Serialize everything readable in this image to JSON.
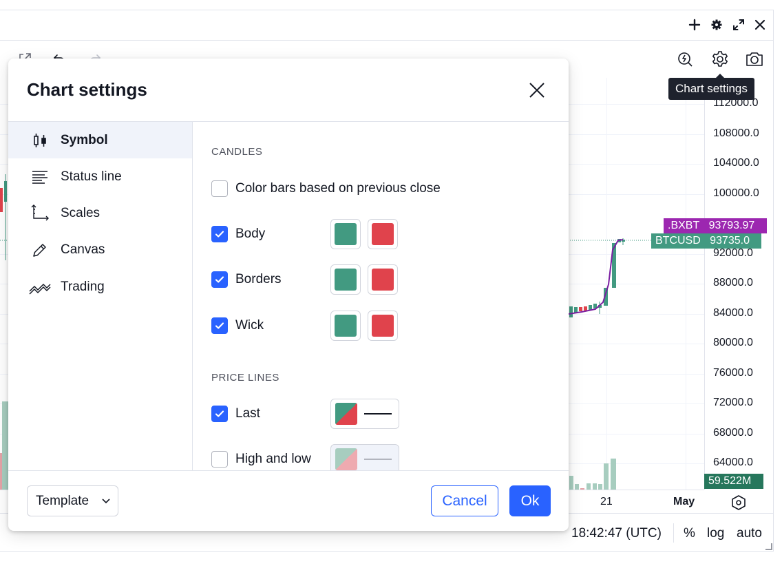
{
  "topbar": {
    "icons": [
      "plus-icon",
      "gear-icon",
      "expand-icon",
      "close-icon"
    ]
  },
  "toolbar": {
    "icons": [
      "popout-icon",
      "undo-icon",
      "redo-icon",
      "quick-search-icon",
      "settings-icon",
      "camera-icon"
    ]
  },
  "tooltip": {
    "text": "Chart settings"
  },
  "price_axis": {
    "ticks": [
      "112000.0",
      "108000.0",
      "104000.0",
      "100000.0",
      "92000.0",
      "88000.0",
      "84000.0",
      "80000.0",
      "76000.0",
      "72000.0",
      "68000.0",
      "64000.0"
    ],
    "tags": [
      {
        "name": ".BXBT",
        "value": "93793.97",
        "color": "#9c27b0"
      },
      {
        "name": "BTCUSD",
        "value": "93735.0",
        "color": "#429a81"
      },
      {
        "name": "",
        "value": "59.522M",
        "color": "#26775c"
      }
    ]
  },
  "time_axis": {
    "labels": [
      "21",
      "May"
    ]
  },
  "bottombar": {
    "time": "18:42:47 (UTC)",
    "percent": "%",
    "log": "log",
    "auto": "auto"
  },
  "modal": {
    "title": "Chart settings",
    "sidebar": [
      {
        "label": "Symbol",
        "icon": "candles-icon",
        "active": true
      },
      {
        "label": "Status line",
        "icon": "status-line-icon",
        "active": false
      },
      {
        "label": "Scales",
        "icon": "scales-icon",
        "active": false
      },
      {
        "label": "Canvas",
        "icon": "pencil-icon",
        "active": false
      },
      {
        "label": "Trading",
        "icon": "trading-icon",
        "active": false
      }
    ],
    "candles": {
      "section": "CANDLES",
      "color_bars_label": "Color bars based on previous close",
      "color_bars_checked": false,
      "rows": [
        {
          "label": "Body",
          "checked": true,
          "up_color": "#429a81",
          "down_color": "#e0434c"
        },
        {
          "label": "Borders",
          "checked": true,
          "up_color": "#429a81",
          "down_color": "#e0434c"
        },
        {
          "label": "Wick",
          "checked": true,
          "up_color": "#429a81",
          "down_color": "#e0434c"
        }
      ]
    },
    "price_lines": {
      "section": "PRICE LINES",
      "rows": [
        {
          "label": "Last",
          "checked": true
        },
        {
          "label": "High and low",
          "checked": false
        }
      ]
    },
    "footer": {
      "template_label": "Template",
      "cancel_label": "Cancel",
      "ok_label": "Ok"
    }
  },
  "colors": {
    "accent": "#2962ff",
    "up": "#429a81",
    "down": "#e0434c",
    "bxbt": "#9c27b0"
  }
}
